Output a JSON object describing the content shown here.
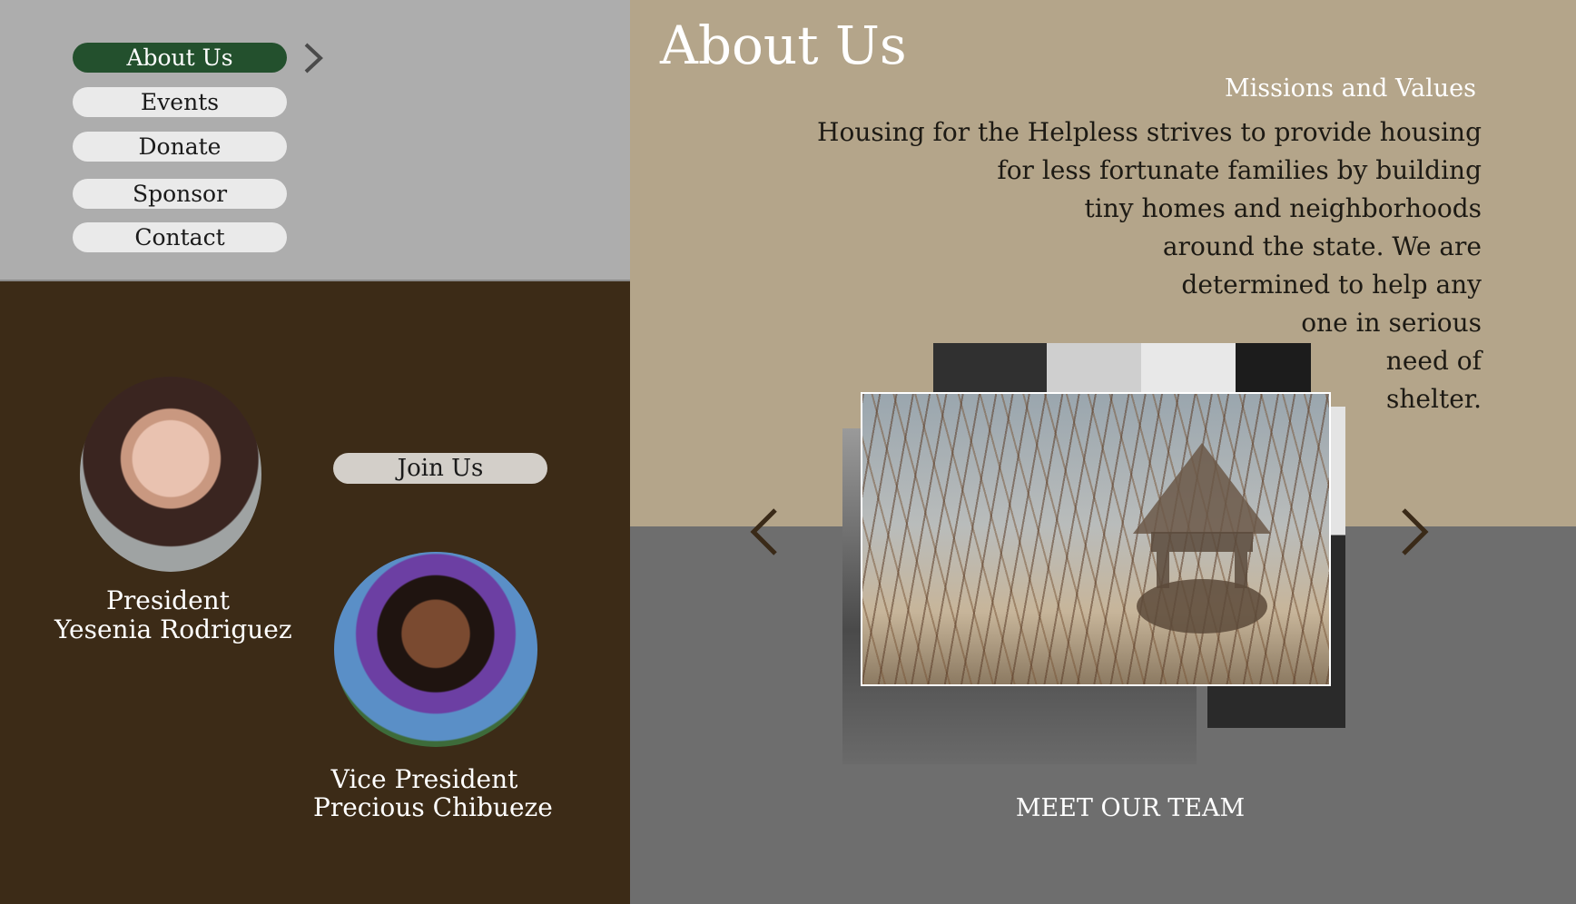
{
  "nav": {
    "items": [
      {
        "label": "About Us",
        "active": true
      },
      {
        "label": "Events",
        "active": false
      },
      {
        "label": "Donate",
        "active": false
      },
      {
        "label": "Sponsor",
        "active": false
      },
      {
        "label": "Contact",
        "active": false
      }
    ],
    "expand_icon": "chevron-right-icon"
  },
  "team": {
    "join_label": "Join Us",
    "members": [
      {
        "role": "President",
        "name": "Yesenia Rodriguez"
      },
      {
        "role": "Vice President",
        "name": "Precious Chibueze"
      }
    ]
  },
  "about": {
    "title": "About Us",
    "mission_heading": "Missions and Values",
    "mission_lines": [
      "Housing for the Helpless strives to provide housing",
      "for less fortunate families by building",
      "tiny homes and neighborhoods",
      "around the state. We are",
      "determined to help any",
      "one in serious",
      "need of",
      "shelter."
    ]
  },
  "gallery": {
    "prev_icon": "chevron-left-icon",
    "next_icon": "chevron-right-icon",
    "team_link": "MEET OUR TEAM"
  },
  "colors": {
    "nav_bg": "#adadad",
    "team_bg": "#3c2b17",
    "about_bg": "#b4a58a",
    "gallery_bg": "#6e6e6e",
    "active_nav": "#23502d"
  }
}
